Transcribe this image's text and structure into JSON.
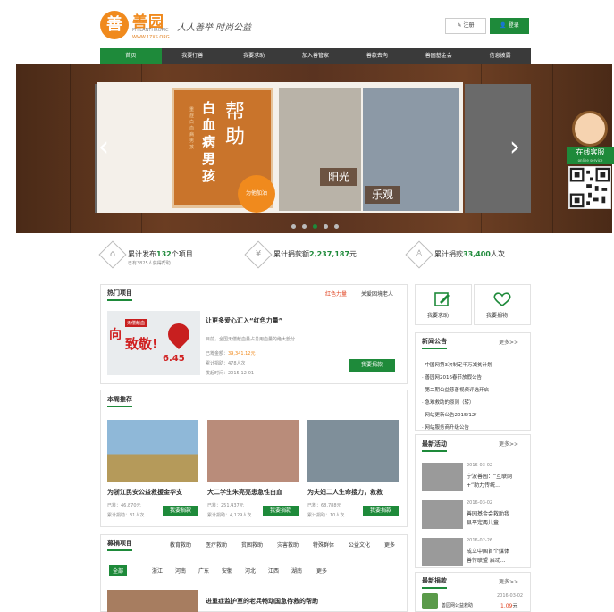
{
  "header": {
    "logo_mark": "善",
    "logo_name": "善园",
    "logo_en": "PHILANTHROPIC",
    "logo_url": "WWW.17XS.ORG",
    "slogan": "人人善举 时尚公益",
    "register_label": "注册",
    "login_label": "登录"
  },
  "nav": [
    "首页",
    "我要行善",
    "我要求助",
    "加入善管家",
    "善款去向",
    "善园基金会",
    "信息披露"
  ],
  "banner": {
    "help_left": "白血病男孩",
    "help_right": "帮助",
    "help_sub": "重症白血病男孩",
    "help_circle": "为他加油",
    "word_sunny": "阳光",
    "word_optimistic": "乐观"
  },
  "customer_service": {
    "label": "在线客服",
    "sub": "online service"
  },
  "stats": [
    {
      "prefix": "累计发布",
      "value": "132",
      "suffix": "个项目",
      "sub": "已有3825人获得帮助"
    },
    {
      "prefix": "累计捐款额",
      "value": "2,237,187",
      "suffix": "元"
    },
    {
      "prefix": "累计捐款",
      "value": "33,400",
      "suffix": "人次"
    }
  ],
  "hot": {
    "title": "热门项目",
    "tab_red": "红色力量",
    "tab_grey": "关爱困境老人",
    "img_line1": "向",
    "img_line2": "致敬!",
    "img_amount": "6.45",
    "img_tag": "无偿献血",
    "project_title": "让更多爱心汇入“红色力量”",
    "project_desc": "目前，全国无偿献血量占总用血量的绝大部分",
    "raised_label": "已筹金额：",
    "raised_value": "39,341.12元",
    "donors": "累计捐助：478人次",
    "date": "发起时间：2015-12-01",
    "donate_btn": "我要捐款"
  },
  "weekly": {
    "title": "本周推荐",
    "cards": [
      {
        "title": "为浙江民安公益救援金华支",
        "raised": "已筹：46,870元",
        "donors": "累计捐助：31人次",
        "btn": "我要捐款"
      },
      {
        "title": "大二学生朱亮亮患急性白血",
        "raised": "已筹：251,437元",
        "donors": "累计捐助：4,129人次",
        "btn": "我要捐款"
      },
      {
        "title": "为夫妇二人生命接力，救救",
        "raised": "已筹：68,788元",
        "donors": "累计捐助：10人次",
        "btn": "我要捐款"
      }
    ]
  },
  "fundraising": {
    "title": "募捐项目",
    "categories": [
      "教育救助",
      "医疗救助",
      "贫困救助",
      "灾害救助",
      "特殊群体",
      "公益文化",
      "更多"
    ],
    "regions": [
      "全部",
      "浙江",
      "河南",
      "广东",
      "安徽",
      "河北",
      "江西",
      "湖南",
      "更多"
    ],
    "item_title": "进重症监护室的老兵畅动国急待救的帮助"
  },
  "sidebar": {
    "seek_help": "我要求助",
    "donate_items": "我要捐物",
    "news_title": "新闻公告",
    "more": "更多>>",
    "news": [
      "中国网第3次制定千万减贫计划",
      "善园网2016春节放假公告",
      "第二期公益慈善视频评选开启",
      "急难救助的原则（转）",
      "网站更新公告2015/12/",
      "网站服务商升级公告"
    ],
    "activity_title": "最新活动",
    "activities": [
      {
        "date": "2016-03-02",
        "line1": "宁波善园：“互联网",
        "line2": "+”助力传统..."
      },
      {
        "date": "2016-03-02",
        "line1": "善园基金会救助我",
        "line2": "县平定两儿童"
      },
      {
        "date": "2016-02-26",
        "line1": "成立中国首个媒体",
        "line2": "善传联盟 启动..."
      }
    ],
    "donation_title": "最新捐款",
    "donation_date": "2016-03-02",
    "donation_amount": "1.09",
    "donation_unit": "元",
    "donation_text": "善园网公益救助"
  }
}
